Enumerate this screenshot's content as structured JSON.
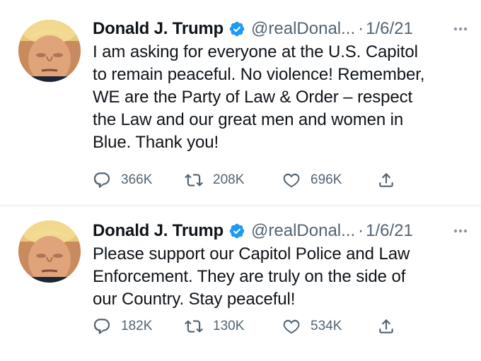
{
  "tweets": [
    {
      "author": {
        "name": "Donald J. Trump",
        "handle": "@realDonal...",
        "verified": true
      },
      "separator": "·",
      "date": "1/6/21",
      "text": "I am asking for everyone at the U.S. Capitol\nto remain peaceful. No violence! Remember,\nWE are the Party of Law & Order – respect\nthe Law and our great men and women in\nBlue. Thank you!",
      "stats": {
        "replies": "366K",
        "retweets": "208K",
        "likes": "696K"
      }
    },
    {
      "author": {
        "name": "Donald J. Trump",
        "handle": "@realDonal...",
        "verified": true
      },
      "separator": "·",
      "date": "1/6/21",
      "text": "Please support our Capitol Police and Law\nEnforcement. They are truly on the side of\nour Country. Stay peaceful!",
      "stats": {
        "replies": "182K",
        "retweets": "130K",
        "likes": "534K"
      }
    }
  ],
  "icons": {
    "verified": "verified-badge-icon",
    "more": "more-horizontal-icon",
    "reply": "reply-icon",
    "retweet": "retweet-icon",
    "like": "heart-icon",
    "share": "share-icon"
  },
  "colors": {
    "text_primary": "#0f1419",
    "text_secondary": "#536471",
    "verified_blue": "#1d9bf0",
    "divider": "#eff3f4"
  }
}
